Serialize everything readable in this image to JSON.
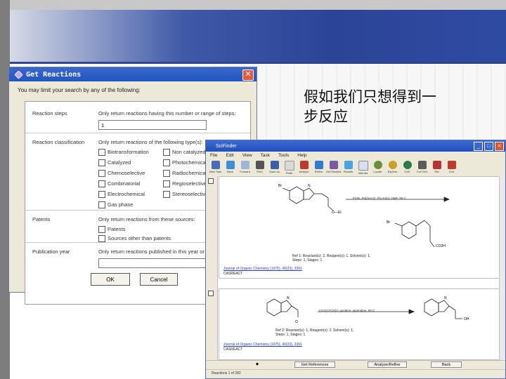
{
  "slide": {
    "heading_line1": "假如我们只想得到一",
    "heading_line2": "步反应"
  },
  "dialog": {
    "title": "Get Reactions",
    "intro": "You may limit your search by any of the following:",
    "rows": {
      "steps": {
        "label": "Reaction steps",
        "desc": "Only return reactions having this number or range of steps:",
        "value": "1"
      },
      "classification": {
        "label": "Reaction classification",
        "desc": "Only return reactions of the following type(s):",
        "left": [
          "Biotransformation",
          "Catalyzed",
          "Chemoselective",
          "Combinatorial",
          "Electrochemical",
          "Gas phase"
        ],
        "right": [
          "Non catalyzed",
          "Photochemical",
          "Radiochemical",
          "Regioselective",
          "Stereoselective"
        ]
      },
      "patents": {
        "label": "Patents",
        "desc": "Only return reactions from these sources:",
        "options": [
          "Patents",
          "Sources other than patents"
        ]
      },
      "year": {
        "label": "Publication year",
        "desc": "Only return reactions published in this year or",
        "value": ""
      }
    },
    "ok_label": "OK",
    "cancel_label": "Cancel"
  },
  "scifinder": {
    "title": "SciFinder",
    "menu": [
      "File",
      "Edit",
      "View",
      "Task",
      "Tools",
      "Help"
    ],
    "toolbar": [
      "New Task",
      "Back",
      "Forward",
      "Print",
      "Save As",
      "Prefs",
      "Analyze",
      "Refine",
      "Get Related",
      "Results",
      "Internet",
      "Locate",
      "Explore",
      "CAS",
      "Full Text",
      "Ref",
      "Exit"
    ],
    "entry1": {
      "conditions": "Et3N, Pd(OAc)2, P(o-tol)3, DMF, 90 C",
      "ref_line1": "Ref 1: Reactant(s): 2, Reagent(s): 1, Solvent(s): 1,",
      "ref_line2": "Steps: 1, Stages: 1",
      "journal": "Journal of Organic Chemistry (1975), 40(23), 3391",
      "source": "CASREACT"
    },
    "entry2": {
      "conditions": "CH2(CO2H)2, pyridine, piperidine, 90 C",
      "ref_line1": "Ref 2: Reactant(s): 1, Reagent(s): 2, Solvent(s): 1,",
      "ref_line2": "Steps: 1, Stages: 1",
      "journal": "Journal of Organic Chemistry (1975), 40(23), 3391",
      "source": "CASREACT"
    },
    "buttons": [
      "Get References",
      "Analyze/Refine",
      "Back"
    ],
    "status": "Reactions 1 of 282"
  }
}
